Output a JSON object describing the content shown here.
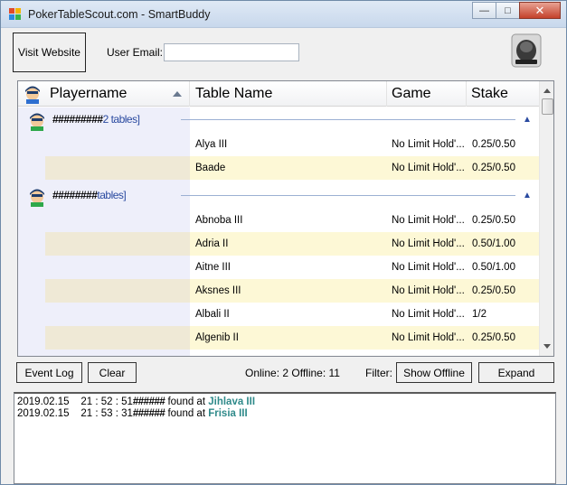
{
  "window": {
    "title": "PokerTableScout.com -  SmartBuddy",
    "minimize": "—",
    "maximize": "□",
    "close": "✕"
  },
  "top": {
    "visit_label": "Visit Website",
    "email_label": "User Email:",
    "email_value": "",
    "email_placeholder": ""
  },
  "grid": {
    "headers": [
      "Playername",
      "Table Name",
      "Game",
      "Stake"
    ],
    "groups": [
      {
        "name": "#########",
        "count": "2 tables]",
        "rows": [
          {
            "table": "Alya III",
            "game": "No Limit Hold'...",
            "stake": "0.25/0.50"
          },
          {
            "table": "Baade",
            "game": "No Limit Hold'...",
            "stake": "0.25/0.50"
          }
        ]
      },
      {
        "name": "########",
        "count": "tables]",
        "rows": [
          {
            "table": "Abnoba III",
            "game": "No Limit Hold'...",
            "stake": "0.25/0.50"
          },
          {
            "table": "Adria II",
            "game": "No Limit Hold'...",
            "stake": "0.50/1.00"
          },
          {
            "table": "Aitne III",
            "game": "No Limit Hold'...",
            "stake": "0.50/1.00"
          },
          {
            "table": "Aksnes III",
            "game": "No Limit Hold'...",
            "stake": "0.25/0.50"
          },
          {
            "table": "Albali II",
            "game": "No Limit Hold'...",
            "stake": "1/2"
          },
          {
            "table": "Algenib II",
            "game": "No Limit Hold'...",
            "stake": "0.25/0.50"
          }
        ]
      }
    ]
  },
  "bottom": {
    "event_log": "Event Log",
    "clear": "Clear",
    "status": "Online: 2 Offline: 11",
    "filter_label": "Filter:",
    "show_offline": "Show Offline",
    "expand": "Expand"
  },
  "log": [
    {
      "date": "2019.02.15",
      "time": "21 : 52 : 51",
      "name": "######",
      "text": " found at ",
      "location": "Jihlava III"
    },
    {
      "date": "2019.02.15",
      "time": "21 : 53 : 31",
      "name": "######",
      "text": " found at ",
      "location": "Frisia III"
    }
  ],
  "colors": {
    "row_alt": "#fdf8d6",
    "group_count": "#2a4aa0",
    "log_location": "#2f8a8a"
  },
  "icons": [
    "app-icon",
    "player-avatar-icon",
    "sort-ascending-icon",
    "collapse-chevron-icon",
    "webcam-bot-icon"
  ]
}
